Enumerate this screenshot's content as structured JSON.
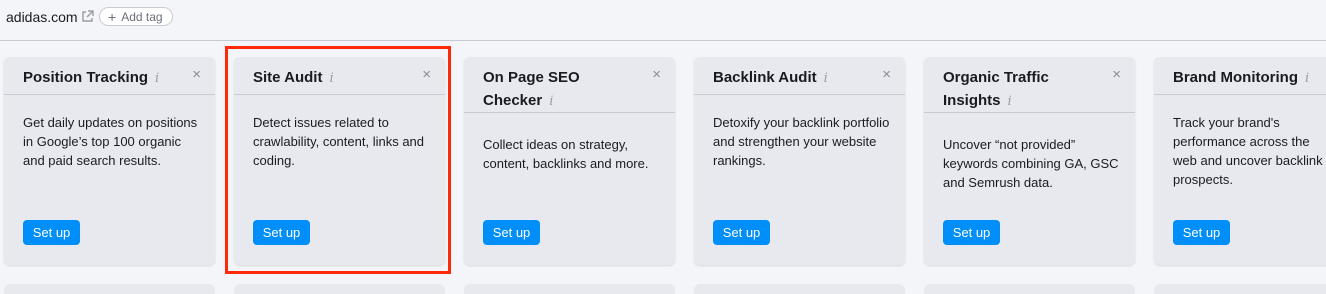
{
  "header": {
    "domain": "adidas.com",
    "add_tag_label": "Add tag"
  },
  "cards": [
    {
      "title": "Position Tracking",
      "description": "Get daily updates on positions in Google’s top 100 organic and paid search results.",
      "button": "Set up"
    },
    {
      "title": "Site Audit",
      "description": "Detect issues related to crawlability, content, links and coding.",
      "button": "Set up",
      "highlighted": true
    },
    {
      "title": "On Page SEO Checker",
      "description": "Collect ideas on strategy, content, backlinks and more.",
      "button": "Set up"
    },
    {
      "title": "Backlink Audit",
      "description": "Detoxify your backlink portfolio and strengthen your website rankings.",
      "button": "Set up"
    },
    {
      "title": "Organic Traffic Insights",
      "description": "Uncover “not provided” keywords combining GA, GSC and Semrush data.",
      "button": "Set up"
    },
    {
      "title": "Brand Monitoring",
      "description": "Track your brand's performance across the web and uncover backlink prospects.",
      "button": "Set up"
    }
  ],
  "colors": {
    "button": "#008ff8",
    "highlight": "#ff2a0a",
    "card_bg": "#e8e9ef",
    "page_bg": "#f4f5f9"
  },
  "icons": {
    "external_link": "external-link-icon",
    "info": "info-icon",
    "close": "close-icon",
    "plus": "plus-icon"
  }
}
